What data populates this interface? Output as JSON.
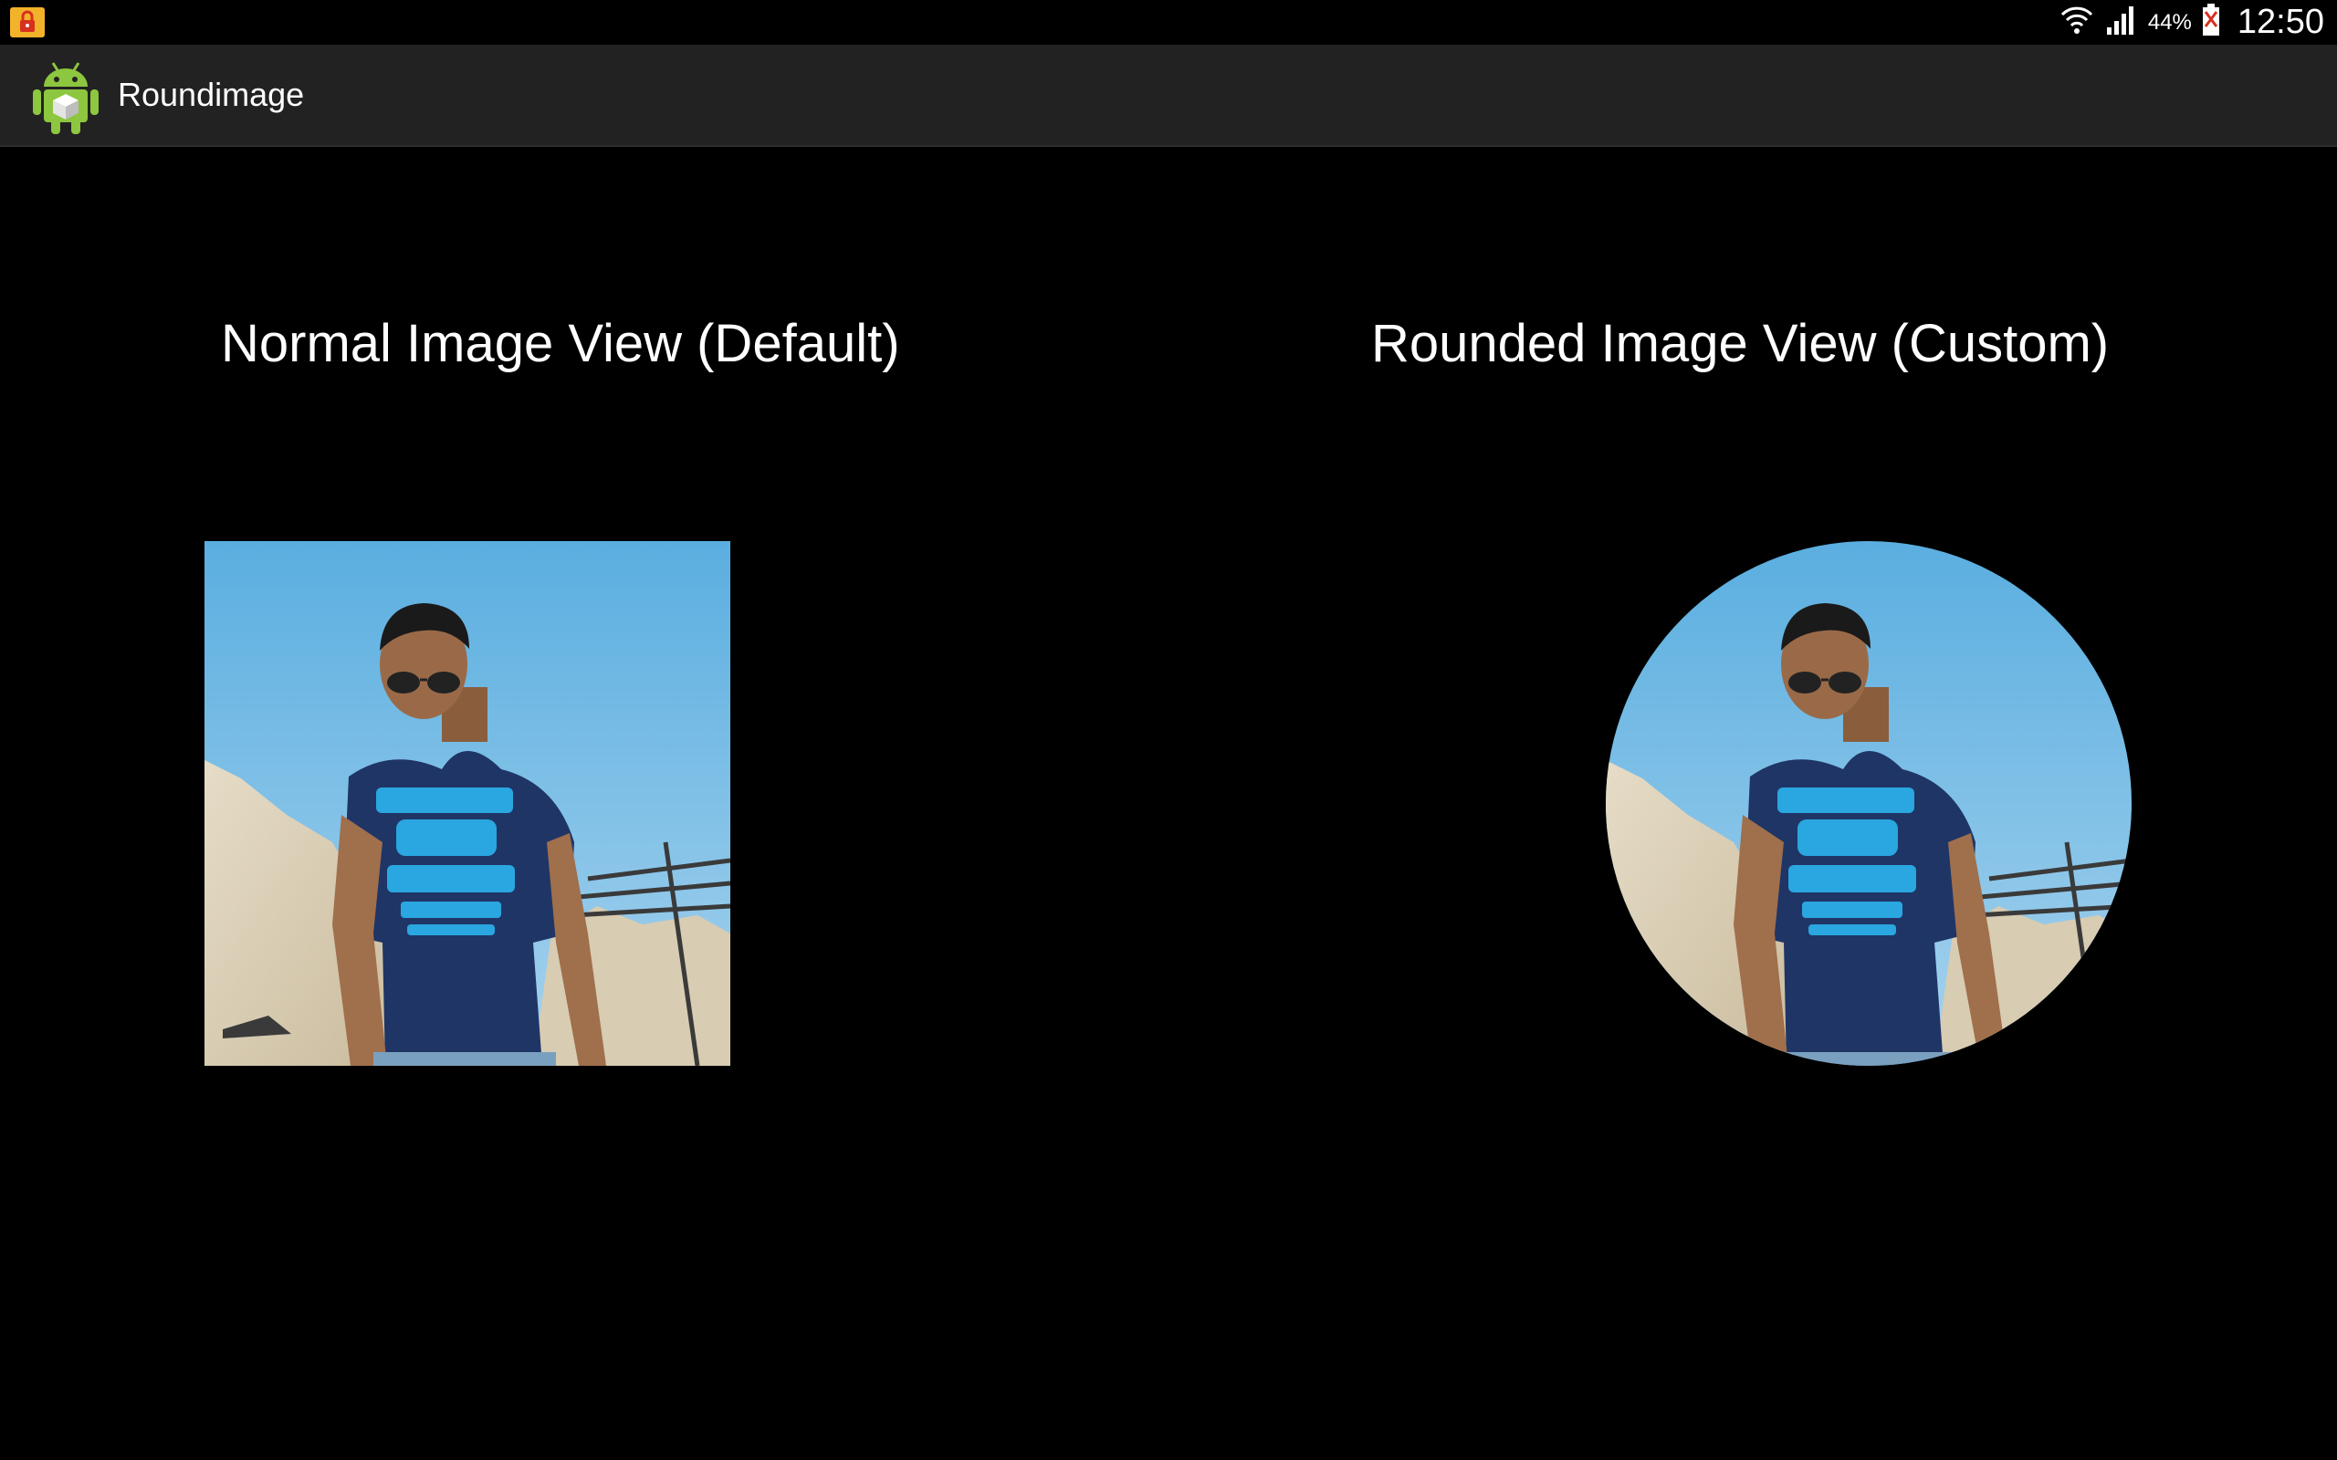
{
  "app": {
    "title": "Roundimage"
  },
  "status_bar": {
    "notification_icon": "lock-icon",
    "wifi_icon": "wifi-icon",
    "signal_icon": "signal-icon",
    "battery_percent": "44%",
    "battery_icon": "battery-icon",
    "time": "12:50"
  },
  "content": {
    "left_title": "Normal Image View (Default)",
    "right_title": "Rounded Image View (Custom)",
    "left_image": "portrait-photo",
    "right_image": "portrait-photo-circular"
  },
  "colors": {
    "background": "#000000",
    "action_bar": "#222222",
    "sky": "#6cb4e2",
    "shirt": "#1f3566",
    "shirt_print": "#2aa6e0"
  }
}
